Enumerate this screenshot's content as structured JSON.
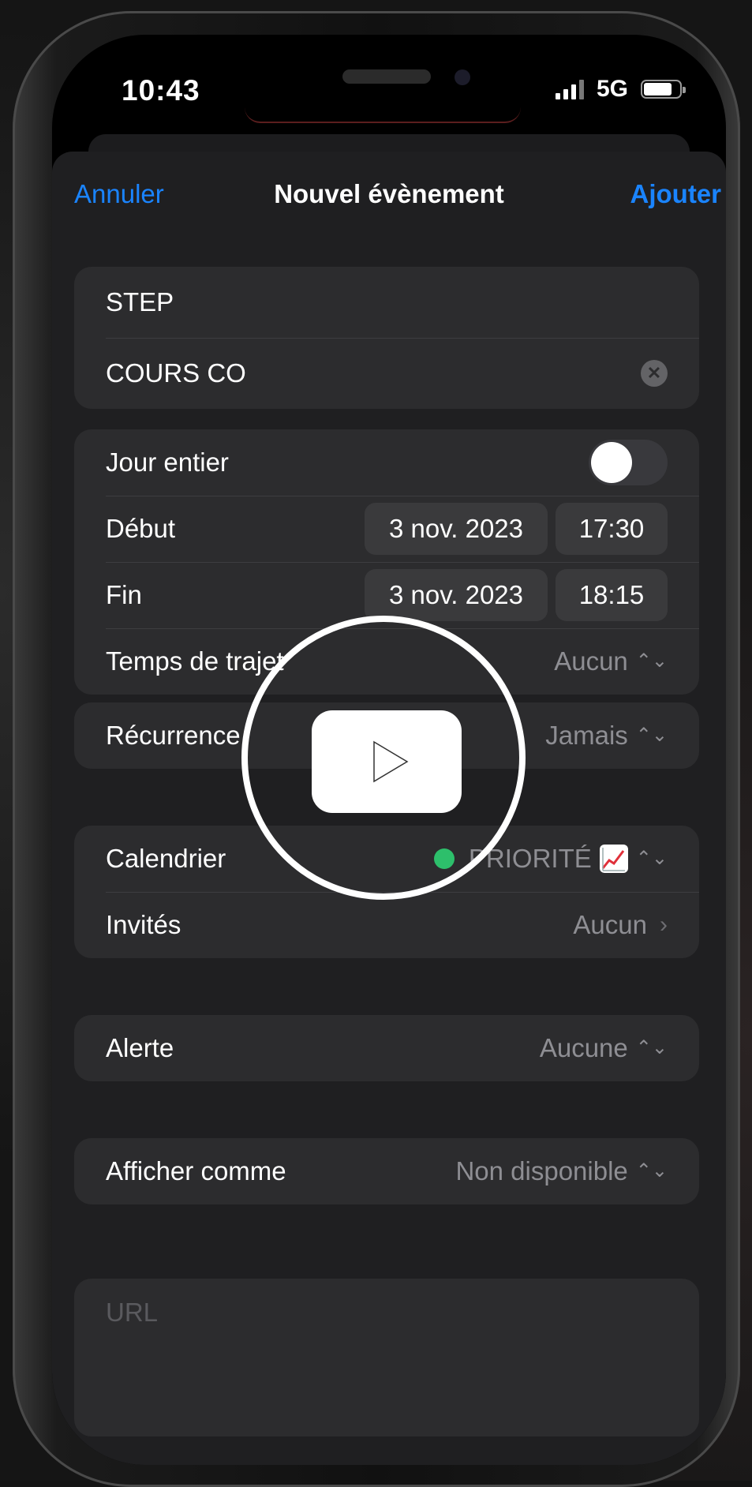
{
  "status": {
    "time": "10:43",
    "network": "5G"
  },
  "nav": {
    "cancel": "Annuler",
    "title": "Nouvel évènement",
    "add": "Ajouter"
  },
  "event": {
    "title": "STEP",
    "location": "COURS CO"
  },
  "datetime": {
    "all_day_label": "Jour entier",
    "all_day_on": false,
    "start_label": "Début",
    "start_date": "3 nov. 2023",
    "start_time": "17:30",
    "end_label": "Fin",
    "end_date": "3 nov. 2023",
    "end_time": "18:15",
    "travel_label": "Temps de trajet",
    "travel_value": "Aucun"
  },
  "repeat": {
    "label": "Récurrence",
    "value": "Jamais"
  },
  "calendar": {
    "label": "Calendrier",
    "value": "PRIORITÉ",
    "color": "#2dbf6b",
    "invitees_label": "Invités",
    "invitees_value": "Aucun"
  },
  "alert": {
    "label": "Alerte",
    "value": "Aucune"
  },
  "show_as": {
    "label": "Afficher comme",
    "value": "Non disponible"
  },
  "url": {
    "placeholder": "URL"
  },
  "colors": {
    "accent": "#1a84ff",
    "background": "#1f1f21",
    "cell": "#2c2c2e"
  }
}
